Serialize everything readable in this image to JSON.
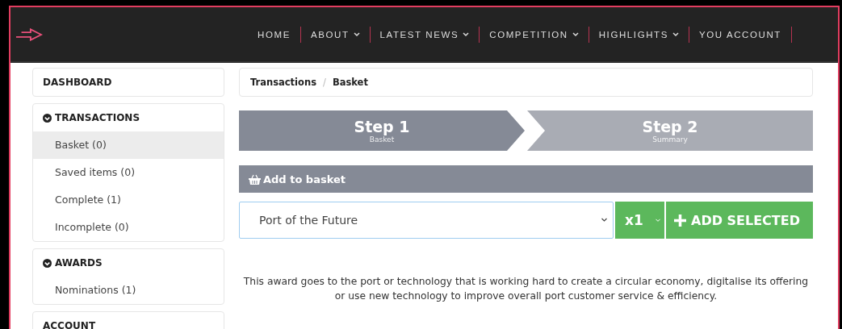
{
  "nav": {
    "items": [
      {
        "label": "HOME",
        "dropdown": false
      },
      {
        "label": "ABOUT",
        "dropdown": true
      },
      {
        "label": "LATEST NEWS",
        "dropdown": true
      },
      {
        "label": "COMPETITION",
        "dropdown": true
      },
      {
        "label": "HIGHLIGHTS",
        "dropdown": true
      },
      {
        "label": "YOU ACCOUNT",
        "dropdown": false
      }
    ]
  },
  "sidebar": {
    "sections": [
      {
        "title": "DASHBOARD",
        "expanded": false
      },
      {
        "title": "TRANSACTIONS",
        "expanded": true,
        "items": [
          {
            "label": "Basket (0)",
            "selected": true
          },
          {
            "label": "Saved items (0)",
            "selected": false
          },
          {
            "label": "Complete (1)",
            "selected": false
          },
          {
            "label": "Incomplete (0)",
            "selected": false
          }
        ]
      },
      {
        "title": "AWARDS",
        "expanded": true,
        "items": [
          {
            "label": "Nominations (1)",
            "selected": false
          }
        ]
      },
      {
        "title": "ACCOUNT",
        "expanded": false
      }
    ]
  },
  "breadcrumb": {
    "items": [
      "Transactions",
      "Basket"
    ],
    "separator": "/"
  },
  "steps": [
    {
      "title": "Step 1",
      "subtitle": "Basket",
      "selected": true
    },
    {
      "title": "Step 2",
      "subtitle": "Summary",
      "selected": false
    }
  ],
  "basket": {
    "title": "Add to basket",
    "award": "Port of the Future",
    "quantity": "x1",
    "button": "ADD SELECTED",
    "description": "This award goes to the port or technology that is working hard to create a circular economy, digitalise its offering or use new technology to improve overall port customer service & efficiency."
  }
}
